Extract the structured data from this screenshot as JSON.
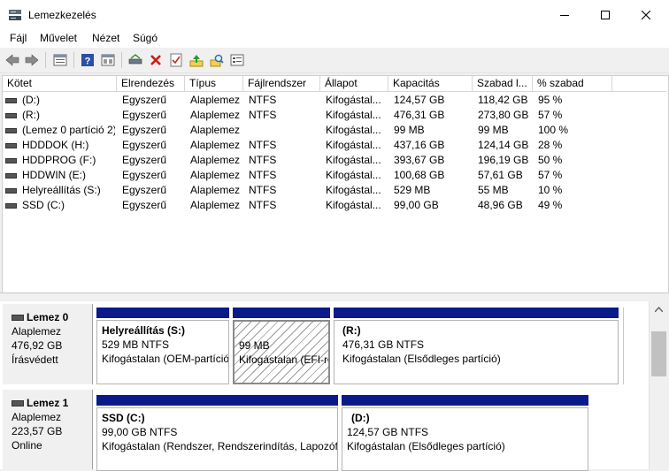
{
  "window": {
    "title": "Lemezkezelés"
  },
  "menu": [
    "Fájl",
    "Művelet",
    "Nézet",
    "Súgó"
  ],
  "columns": [
    "Kötet",
    "Elrendezés",
    "Típus",
    "Fájlrendszer",
    "Állapot",
    "Kapacitás",
    "Szabad l...",
    "% szabad"
  ],
  "volumes": [
    [
      "(D:)",
      "Egyszerű",
      "Alaplemez",
      "NTFS",
      "Kifogástal...",
      "124,57 GB",
      "118,42 GB",
      "95 %"
    ],
    [
      "(R:)",
      "Egyszerű",
      "Alaplemez",
      "NTFS",
      "Kifogástal...",
      "476,31 GB",
      "273,80 GB",
      "57 %"
    ],
    [
      "(Lemez 0 partíció 2)",
      "Egyszerű",
      "Alaplemez",
      "",
      "Kifogástal...",
      "99 MB",
      "99 MB",
      "100 %"
    ],
    [
      "HDDDOK (H:)",
      "Egyszerű",
      "Alaplemez",
      "NTFS",
      "Kifogástal...",
      "437,16 GB",
      "124,14 GB",
      "28 %"
    ],
    [
      "HDDPROG (F:)",
      "Egyszerű",
      "Alaplemez",
      "NTFS",
      "Kifogástal...",
      "393,67 GB",
      "196,19 GB",
      "50 %"
    ],
    [
      "HDDWIN (E:)",
      "Egyszerű",
      "Alaplemez",
      "NTFS",
      "Kifogástal...",
      "100,68 GB",
      "57,61 GB",
      "57 %"
    ],
    [
      "Helyreállítás (S:)",
      "Egyszerű",
      "Alaplemez",
      "NTFS",
      "Kifogástal...",
      "529 MB",
      "55 MB",
      "10 %"
    ],
    [
      "SSD (C:)",
      "Egyszerű",
      "Alaplemez",
      "NTFS",
      "Kifogástal...",
      "99,00 GB",
      "48,96 GB",
      "49 %"
    ]
  ],
  "disks": [
    {
      "name": "Lemez 0",
      "type": "Alaplemez",
      "size": "476,92 GB",
      "status": "Írásvédett",
      "partitions": [
        {
          "title": "Helyreállítás  (S:)",
          "size": "529 MB NTFS",
          "status": "Kifogástalan (OEM-partíció)"
        },
        {
          "title": "",
          "size": "99 MB",
          "status": "Kifogástalan (EFI-rendszerpartíció)"
        },
        {
          "title": "(R:)",
          "size": "476,31 GB NTFS",
          "status": "Kifogástalan (Elsődleges partíció)"
        }
      ]
    },
    {
      "name": "Lemez 1",
      "type": "Alaplemez",
      "size": "223,57 GB",
      "status": "Online",
      "partitions": [
        {
          "title": "SSD  (C:)",
          "size": "99,00 GB NTFS",
          "status": "Kifogástalan (Rendszer, Rendszerindítás, Lapozófájl)"
        },
        {
          "title": "(D:)",
          "size": "124,57 GB NTFS",
          "status": "Kifogástalan (Elsődleges partíció)"
        }
      ]
    }
  ],
  "toolbar_icons": [
    "back-icon",
    "forward-icon",
    "list-view-icon",
    "help-icon",
    "console-tree-icon",
    "connect-disk-icon",
    "delete-icon",
    "properties-checklist-icon",
    "refresh-up-icon",
    "search-icon",
    "settings-panel-icon"
  ],
  "colors": {
    "partition_bar": "#0a1a8a",
    "selection": "#e5e5e5"
  }
}
